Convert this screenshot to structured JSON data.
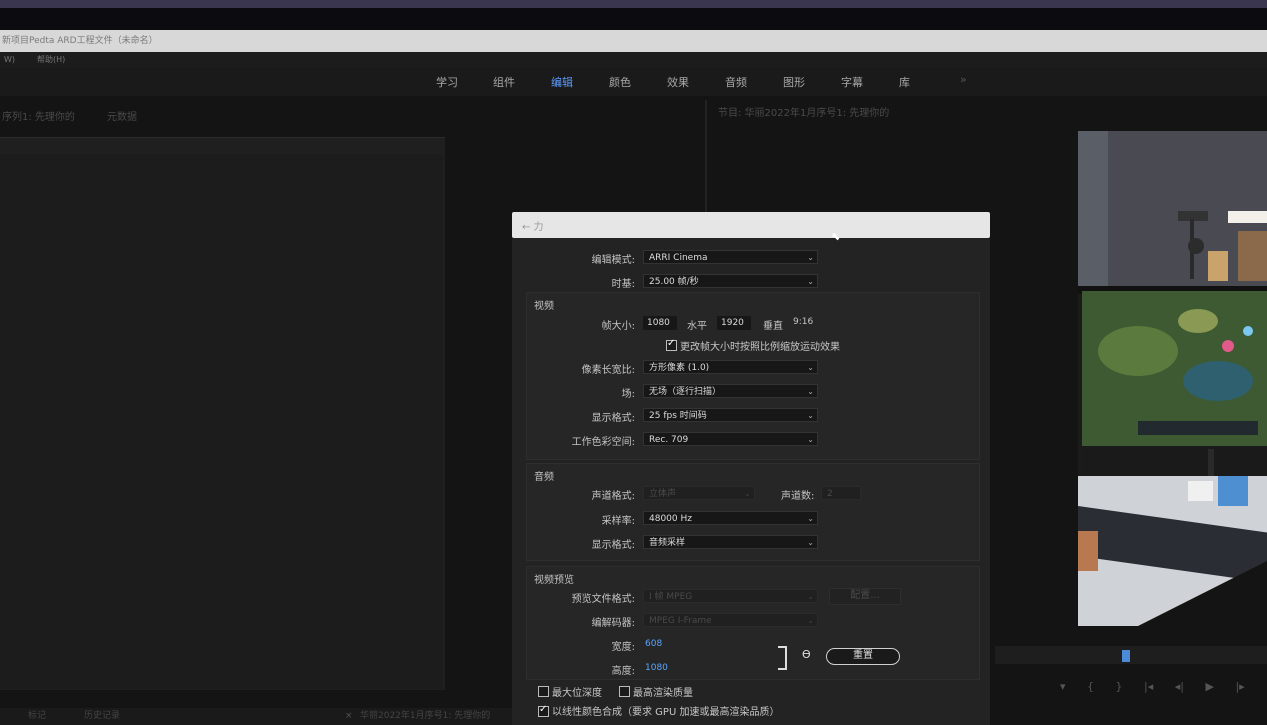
{
  "window": {
    "title": "新项目Pedta ARD工程文件（未命名）",
    "menu": [
      "W)",
      "帮助(H)"
    ]
  },
  "workspaces": {
    "tabs": [
      {
        "label": "学习"
      },
      {
        "label": "组件"
      },
      {
        "label": "编辑",
        "active": true
      },
      {
        "label": "颜色"
      },
      {
        "label": "效果"
      },
      {
        "label": "音频"
      },
      {
        "label": "图形"
      },
      {
        "label": "字幕"
      },
      {
        "label": "库"
      }
    ],
    "more": "»"
  },
  "left_panel": {
    "tab_source": "序列1: 先理你的",
    "tab_metadata": "元数据"
  },
  "program_panel": {
    "title": "节目: 华丽2022年1月序号1: 先理你的"
  },
  "bottom_tabs": {
    "markers": "标记",
    "history": "历史记录",
    "sequence": "华丽2022年1月序号1: 先理你的"
  },
  "dialog": {
    "title": "←  力",
    "edit_mode_label": "编辑模式:",
    "edit_mode_value": "ARRI Cinema",
    "timebase_label": "时基:",
    "timebase_value": "25.00  帧/秒",
    "video_section": "视频",
    "frame_size_label": "帧大小:",
    "frame_width": "1080",
    "horizontal_label": "水平",
    "frame_height": "1920",
    "vertical_label": "垂直",
    "aspect": "9:16",
    "scale_checkbox_label": "更改帧大小时按照比例缩放运动效果",
    "pixel_aspect_label": "像素长宽比:",
    "pixel_aspect_value": "方形像素 (1.0)",
    "field_label": "场:",
    "field_value": "无场（逐行扫描）",
    "display_format_label": "显示格式:",
    "display_format_value": "25 fps 时间码",
    "color_space_label": "工作色彩空间:",
    "color_space_value": "Rec. 709",
    "audio_section": "音频",
    "channel_format_label": "声道格式:",
    "channel_format_value": "立体声",
    "channel_count_label": "声道数:",
    "channel_count_value": "2",
    "sample_rate_label": "采样率:",
    "sample_rate_value": "48000 Hz",
    "audio_display_label": "显示格式:",
    "audio_display_value": "音频采样",
    "preview_section": "视频预览",
    "preview_format_label": "预览文件格式:",
    "preview_format_value": "I 帧 MPEG",
    "configure_button": "配置...",
    "codec_label": "编解码器:",
    "codec_value": "MPEG I-Frame",
    "width_label": "宽度:",
    "width_value": "608",
    "height_label": "高度:",
    "height_value": "1080",
    "reset_button": "重置",
    "max_depth_label": "最大位深度",
    "max_quality_label": "最高渲染质量",
    "linear_color_label": "以线性颜色合成（要求 GPU 加速或最高渲染品质）"
  }
}
